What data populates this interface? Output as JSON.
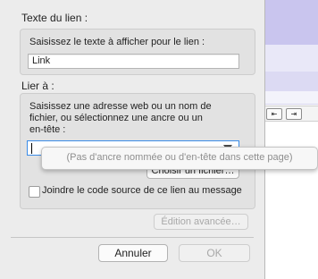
{
  "dialog": {
    "link_text_section": "Texte du lien :",
    "link_text_prompt": "Saisissez le texte à afficher pour le lien :",
    "link_text_value": "Link",
    "link_to_section": "Lier à :",
    "link_to_prompt_line1": "Saisissez une adresse web ou un nom de",
    "link_to_prompt_line2": "fichier, ou sélectionnez une ancre ou un",
    "link_to_prompt_line3": "en-tête :",
    "link_to_value": "",
    "dropdown_empty_text": "(Pas d'ancre nommée ou d'en-tête dans cette page)",
    "choose_file_button": "Choisir un fichier…",
    "embed_source_label": "Joindre le code source de ce lien au message",
    "embed_source_checked": false,
    "advanced_button": "Édition avancée…",
    "cancel_button": "Annuler",
    "ok_button": "OK"
  },
  "background_toolbar": {
    "outdent_glyph": "⇤",
    "indent_glyph": "⇥"
  },
  "icons": {
    "combo_arrow": "chevron-down-icon",
    "outdent": "outdent-icon",
    "indent": "indent-icon"
  },
  "colors": {
    "focus_ring": "#3a8ce8",
    "background_header": "#c9c5ee"
  }
}
